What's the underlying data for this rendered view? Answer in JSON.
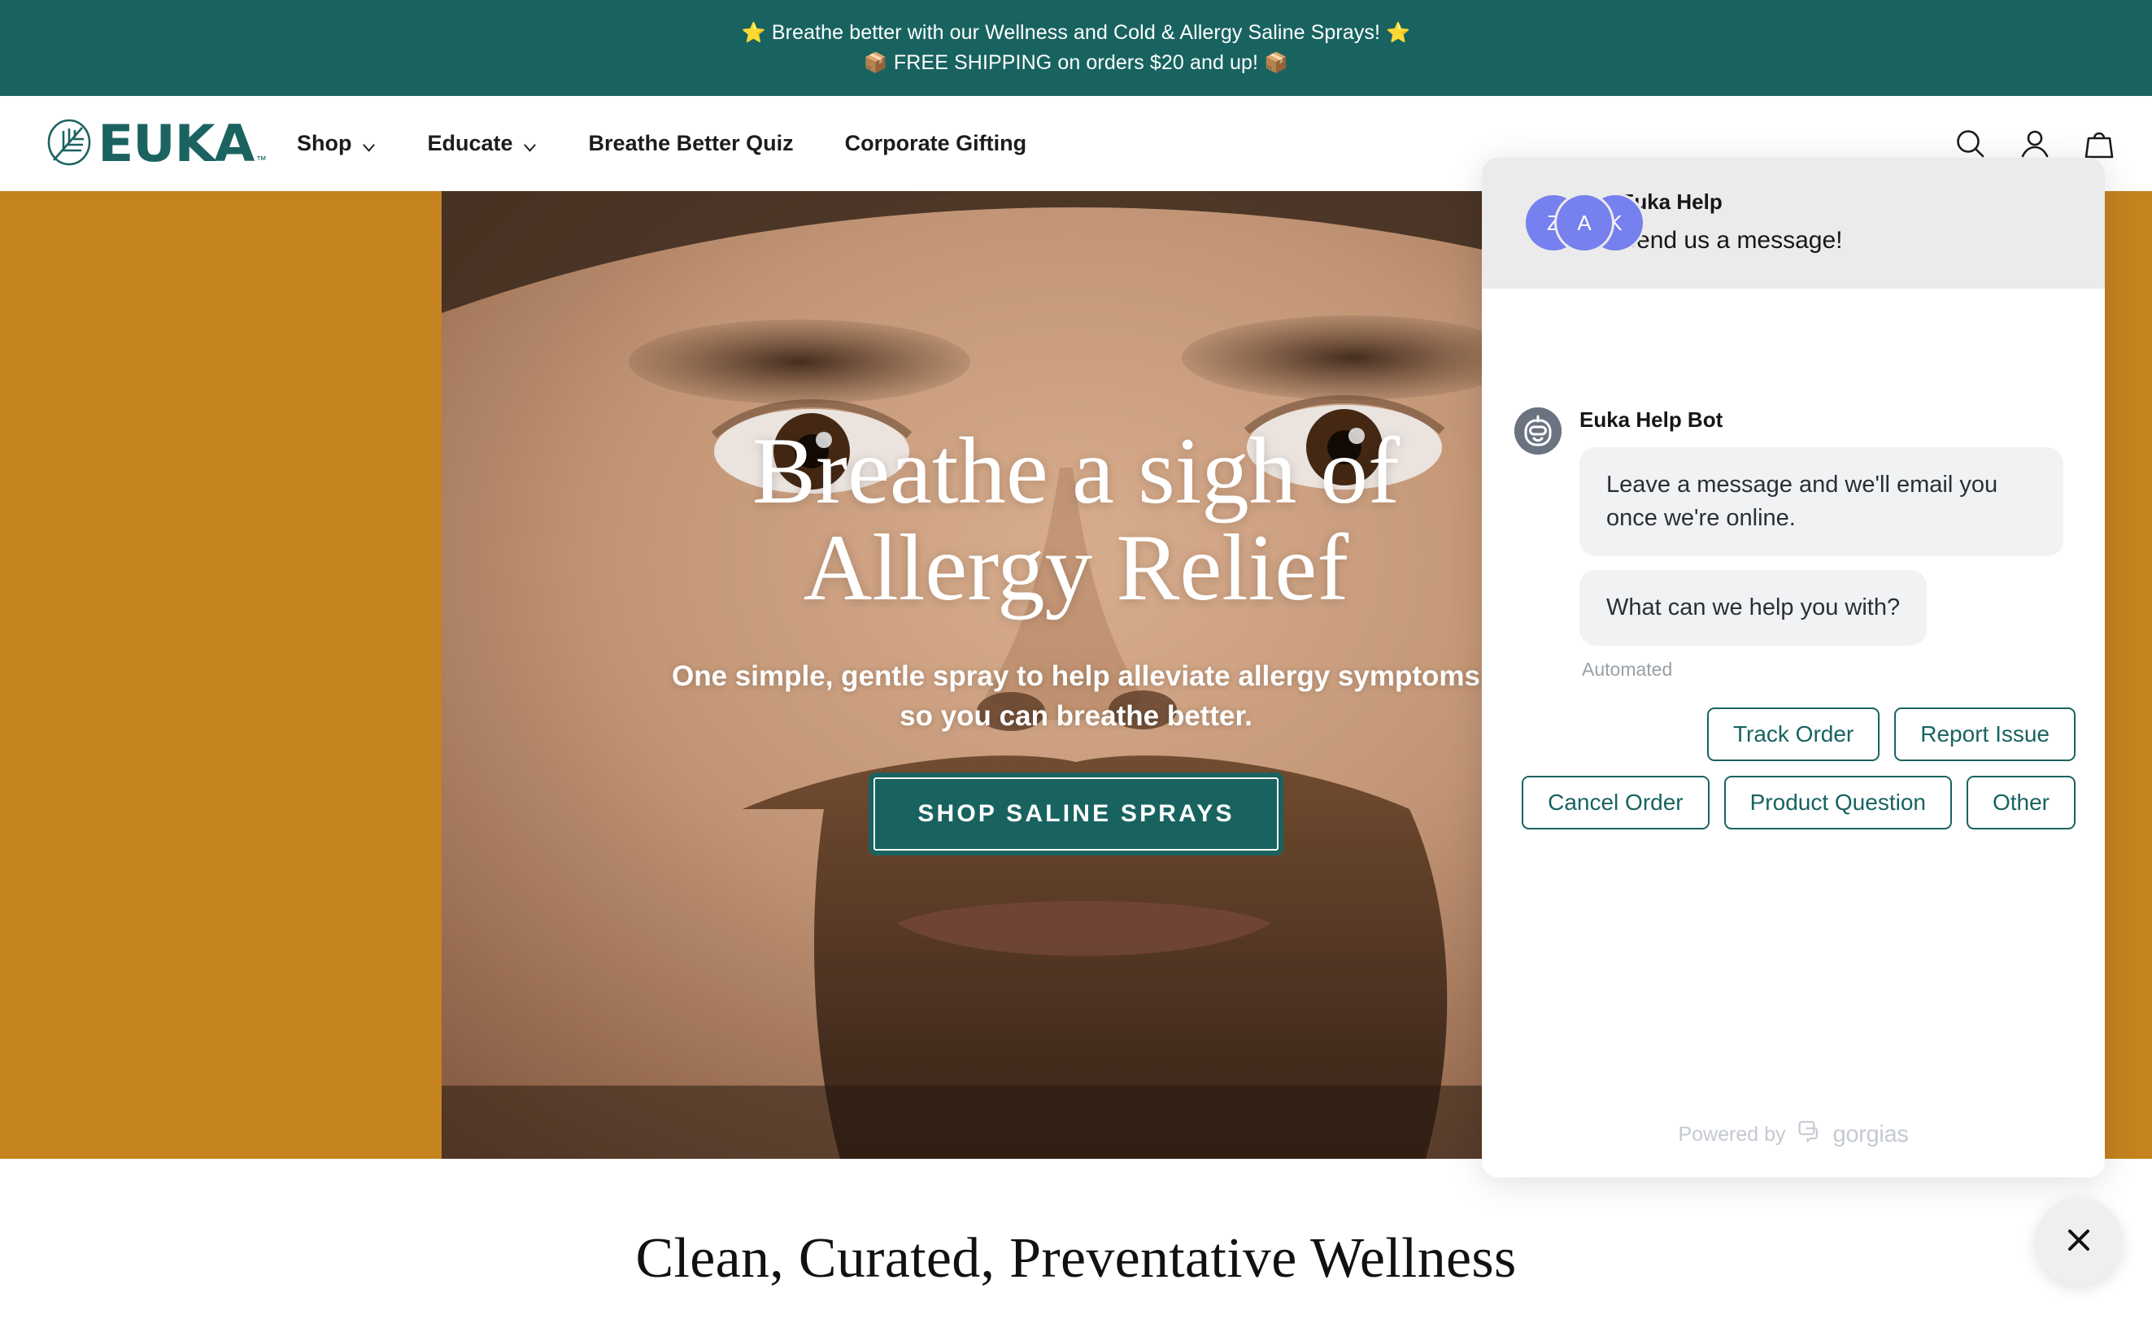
{
  "announcement": {
    "line1_emoji_left": "⭐",
    "line1": "Breathe better with our Wellness and Cold & Allergy Saline Sprays!",
    "line1_emoji_right": "⭐",
    "line2_emoji_left": "📦",
    "line2": "FREE SHIPPING on orders $20 and up!",
    "line2_emoji_right": "📦",
    "bg_color": "#186360"
  },
  "header": {
    "logo_text": "EUKA",
    "logo_tm": "™",
    "nav": [
      {
        "label": "Shop",
        "has_dropdown": true
      },
      {
        "label": "Educate",
        "has_dropdown": true
      },
      {
        "label": "Breathe Better Quiz",
        "has_dropdown": false
      },
      {
        "label": "Corporate Gifting",
        "has_dropdown": false
      }
    ],
    "icons": [
      "search-icon",
      "account-icon",
      "cart-icon"
    ]
  },
  "hero": {
    "title_line1": "Breathe a sigh of",
    "title_line2": "Allergy Relief",
    "subtitle": "One simple, gentle spray to help alleviate allergy symptoms so you can breathe better.",
    "cta_label": "SHOP SALINE SPRAYS",
    "bg_color": "#c5831f",
    "accent_color": "#186360"
  },
  "section": {
    "title": "Clean, Curated, Preventative Wellness"
  },
  "chat": {
    "header": {
      "title": "Euka Help",
      "subtitle": "Send us a message!",
      "avatar_initials": [
        "Z",
        "A",
        "K"
      ],
      "avatar_color": "#7680ee"
    },
    "bot": {
      "name": "Euka Help Bot",
      "messages": [
        "Leave a message and we'll email you once we're online.",
        "What can we help you with?"
      ],
      "meta_label": "Automated"
    },
    "quick_replies": [
      "Track Order",
      "Report Issue",
      "Cancel Order",
      "Product Question",
      "Other"
    ],
    "footer": {
      "powered_by": "Powered by",
      "brand": "gorgias"
    }
  },
  "fab": {
    "label": "close-chat"
  }
}
